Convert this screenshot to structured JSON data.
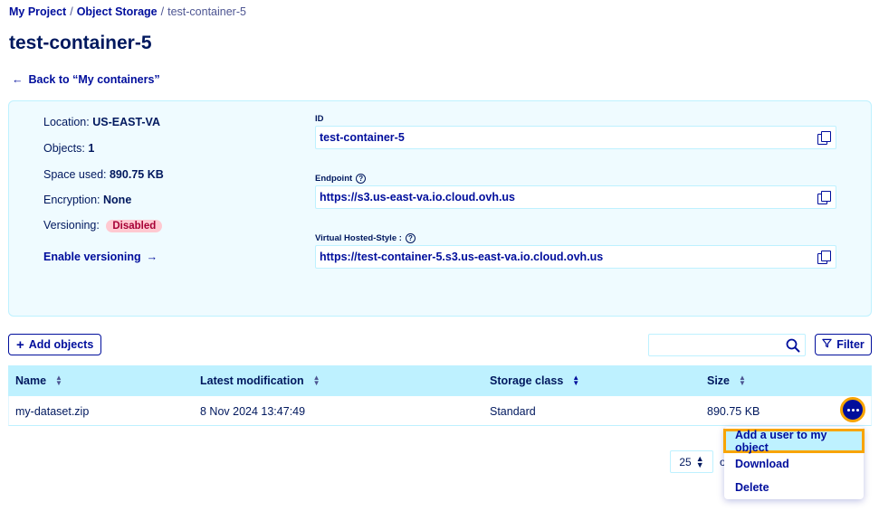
{
  "breadcrumb": {
    "items": [
      "My Project",
      "Object Storage"
    ],
    "separator": "/",
    "current": "test-container-5"
  },
  "page_title": "test-container-5",
  "back_link": {
    "arrow": "←",
    "label": "Back to “My containers”"
  },
  "info": {
    "location_label": "Location:",
    "location_value": "US-EAST-VA",
    "objects_label": "Objects:",
    "objects_value": "1",
    "space_label": "Space used:",
    "space_value": "890.75 KB",
    "encryption_label": "Encryption:",
    "encryption_value": "None",
    "versioning_label": "Versioning:",
    "versioning_value": "Disabled",
    "enable_versioning": "Enable versioning",
    "arrow": "→"
  },
  "fields": {
    "id_label": "ID",
    "id_value": "test-container-5",
    "endpoint_label": "Endpoint",
    "endpoint_value": "https://s3.us-east-va.io.cloud.ovh.us",
    "vhs_label": "Virtual Hosted-Style :",
    "vhs_value": "https://test-container-5.s3.us-east-va.io.cloud.ovh.us",
    "help_glyph": "?"
  },
  "toolbar": {
    "add_objects": "Add objects",
    "add_glyph": "+",
    "search_value": "",
    "filter": "Filter"
  },
  "table": {
    "columns": [
      "Name",
      "Latest modification",
      "Storage class",
      "Size"
    ],
    "rows": [
      {
        "name": "my-dataset.zip",
        "modified": "8 Nov 2024 13:47:49",
        "storage_class": "Standard",
        "size": "890.75 KB"
      }
    ]
  },
  "pagination": {
    "page_size": "25",
    "of_text": "o"
  },
  "context_menu": {
    "items": [
      "Add a user to my object",
      "Download",
      "Delete"
    ]
  },
  "colors": {
    "primary": "#000e9c",
    "text": "#00185e",
    "highlight_border": "#f8a400",
    "panel_bg": "#effbff",
    "header_bg": "#bef1ff",
    "badge_bg": "#ffc9d1"
  }
}
